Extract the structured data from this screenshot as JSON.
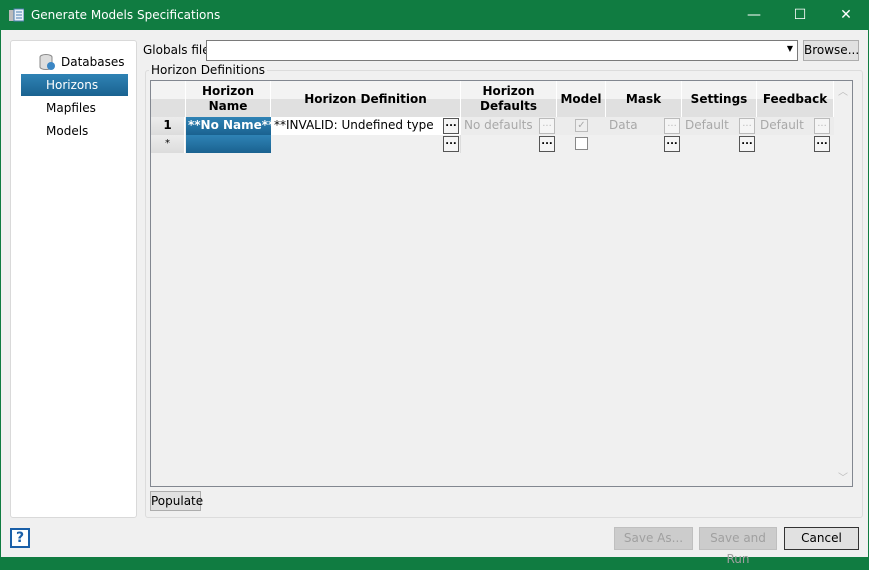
{
  "window": {
    "title": "Generate Models Specifications",
    "minimize": "—",
    "maximize": "☐",
    "close": "✕"
  },
  "sidebar": {
    "items": [
      {
        "label": "Databases",
        "icon": "database-icon"
      },
      {
        "label": "Horizons",
        "selected": true
      },
      {
        "label": "Mapfiles"
      },
      {
        "label": "Models"
      }
    ]
  },
  "globals": {
    "label": "Globals file",
    "value": "",
    "browse_label": "Browse..."
  },
  "horizon_definitions": {
    "group_label": "Horizon Definitions",
    "columns": [
      "Horizon Name",
      "Horizon Definition",
      "Horizon Defaults",
      "Model",
      "Mask",
      "Settings",
      "Feedback"
    ],
    "rows": [
      {
        "header": "1",
        "name": "**No Name**",
        "definition": "**INVALID: Undefined type",
        "defaults": "No defaults",
        "model": true,
        "mask": "Data",
        "settings": "Default",
        "feedback": "Default"
      },
      {
        "header": "*",
        "name": "",
        "definition": "",
        "defaults": "",
        "model": false,
        "mask": "",
        "settings": "",
        "feedback": ""
      }
    ],
    "ellipsis": "...",
    "populate_label": "Populate"
  },
  "footer": {
    "help": "?",
    "save_as_label": "Save As...",
    "save_and_run_label": "Save and Run",
    "cancel_label": "Cancel"
  },
  "colors": {
    "titlebar": "#107c41",
    "selection": "#1f6f9f"
  }
}
